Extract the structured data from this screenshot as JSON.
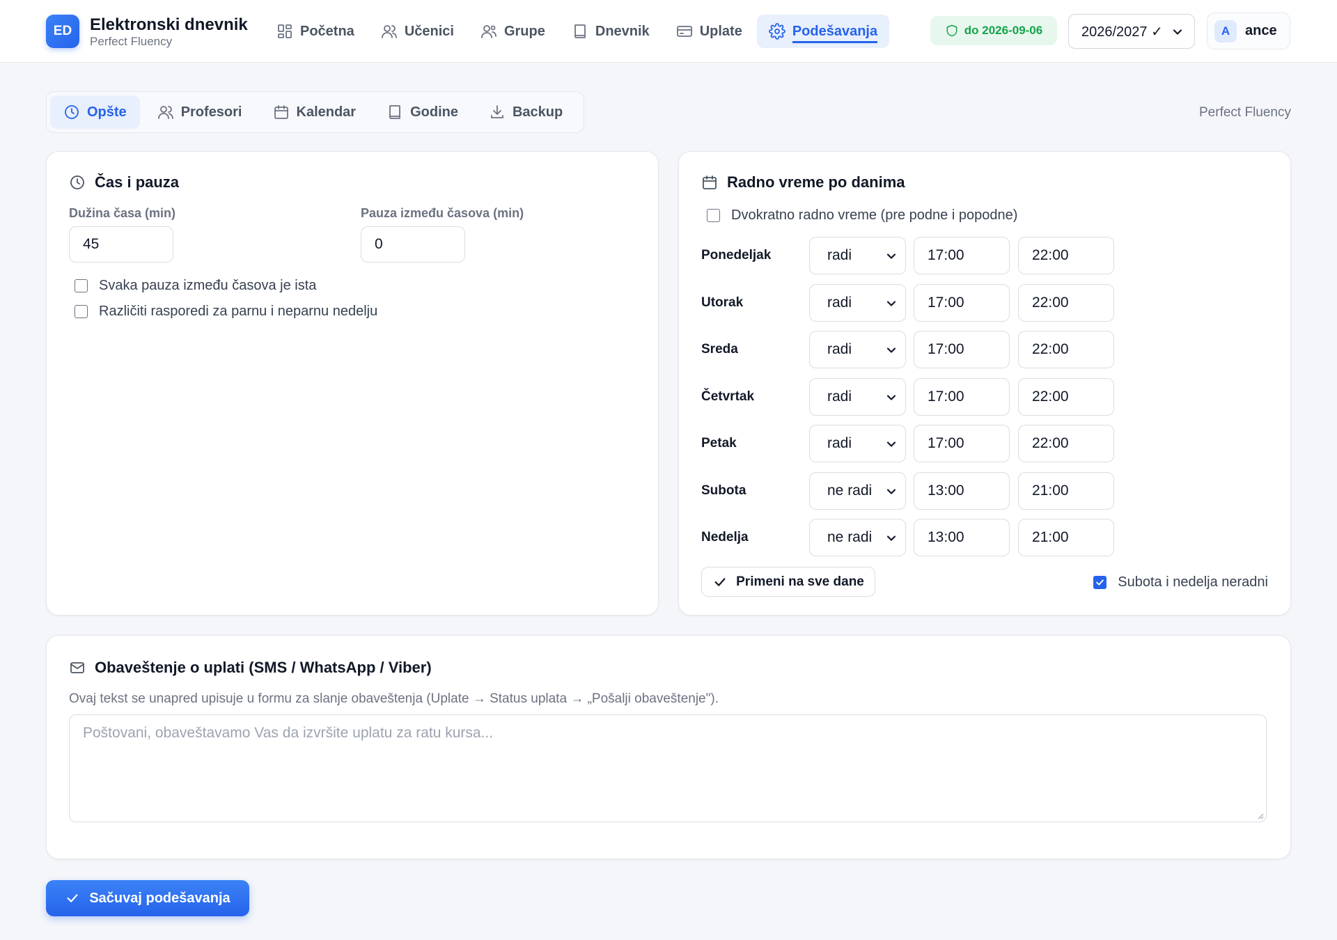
{
  "brand": {
    "logo": "ED",
    "title": "Elektronski dnevnik",
    "subtitle": "Perfect Fluency"
  },
  "nav": [
    {
      "label": "Početna",
      "icon": "dashboard-icon"
    },
    {
      "label": "Učenici",
      "icon": "users-icon"
    },
    {
      "label": "Grupe",
      "icon": "group-icon"
    },
    {
      "label": "Dnevnik",
      "icon": "book-icon"
    },
    {
      "label": "Uplate",
      "icon": "credit-card-icon"
    },
    {
      "label": "Podešavanja",
      "icon": "gear-icon",
      "active": true
    }
  ],
  "license": {
    "label": "do 2026-09-06",
    "icon": "shield-icon"
  },
  "year_select": {
    "value": "2026/2027 ✓"
  },
  "user": {
    "initial": "A",
    "name": "ance"
  },
  "tabs": [
    {
      "label": "Opšte",
      "icon": "clock-icon",
      "active": true
    },
    {
      "label": "Profesori",
      "icon": "users-icon"
    },
    {
      "label": "Kalendar",
      "icon": "calendar-icon"
    },
    {
      "label": "Godine",
      "icon": "book-icon"
    },
    {
      "label": "Backup",
      "icon": "download-icon"
    }
  ],
  "tenant": "Perfect Fluency",
  "lesson": {
    "title": "Čas i pauza",
    "duration_label": "Dužina časa (min)",
    "duration_value": "45",
    "pause_label": "Pauza između časova (min)",
    "pause_value": "0",
    "same_pause_label": "Svaka pauza između časova je ista",
    "same_pause_checked": false,
    "odd_even_label": "Različiti rasporedi za parnu i neparnu nedelju",
    "odd_even_checked": false
  },
  "hours": {
    "title": "Radno vreme po danima",
    "split_label": "Dvokratno radno vreme (pre podne i popodne)",
    "split_checked": false,
    "days": [
      {
        "name": "Ponedeljak",
        "status": "radi",
        "from": "17:00",
        "to": "22:00"
      },
      {
        "name": "Utorak",
        "status": "radi",
        "from": "17:00",
        "to": "22:00"
      },
      {
        "name": "Sreda",
        "status": "radi",
        "from": "17:00",
        "to": "22:00"
      },
      {
        "name": "Četvrtak",
        "status": "radi",
        "from": "17:00",
        "to": "22:00"
      },
      {
        "name": "Petak",
        "status": "radi",
        "from": "17:00",
        "to": "22:00"
      },
      {
        "name": "Subota",
        "status": "ne radi",
        "from": "13:00",
        "to": "21:00"
      },
      {
        "name": "Nedelja",
        "status": "ne radi",
        "from": "13:00",
        "to": "21:00"
      }
    ],
    "apply_label": "Primeni na sve dane",
    "weekend_label": "Subota i nedelja neradni",
    "weekend_checked": true
  },
  "notice": {
    "title": "Obaveštenje o uplati (SMS / WhatsApp / Viber)",
    "description": "Ovaj tekst se unapred upisuje u formu za slanje obaveštenja (Uplate → Status uplata → „Pošalji obaveštenje\").",
    "placeholder": "Poštovani, obaveštavamo Vas da izvršite uplatu za ratu kursa..."
  },
  "save_label": "Sačuvaj podešavanja",
  "colors": {
    "accent": "#2563eb",
    "success": "#16a34a",
    "background": "#f4f6fa"
  }
}
